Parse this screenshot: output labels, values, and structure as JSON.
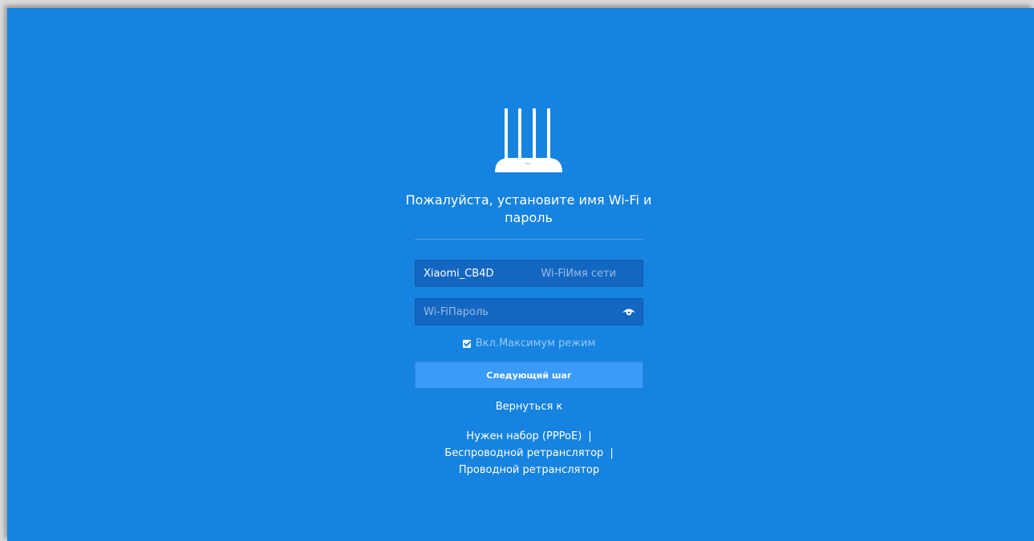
{
  "setup": {
    "title": "Пожалуйста, установите имя Wi-Fi и пароль",
    "ssid": {
      "value": "Xiaomi_CB4D",
      "hint": "Wi-FiИмя сети"
    },
    "password": {
      "placeholder": "Wi-FiПароль",
      "toggle_icon": "eye-icon"
    },
    "max_mode": {
      "checked": true,
      "label": "Вкл.Максимум режим"
    },
    "next_button": "Следующий шаг",
    "back_link": "Вернуться к",
    "alt_links": [
      {
        "label": "Нужен набор (PPPoE)",
        "separator": "|"
      },
      {
        "label": "Беспроводной ретранслятор",
        "separator": "|"
      },
      {
        "label": "Проводной ретранслятор",
        "separator": ""
      }
    ]
  },
  "colors": {
    "background": "#1683e0",
    "field": "#1467c1",
    "button": "#3a9bf8",
    "text": "#ffffff"
  },
  "icons": {
    "router": "router-icon",
    "eye": "eye-icon",
    "checkbox": "checkbox-checked-icon"
  }
}
